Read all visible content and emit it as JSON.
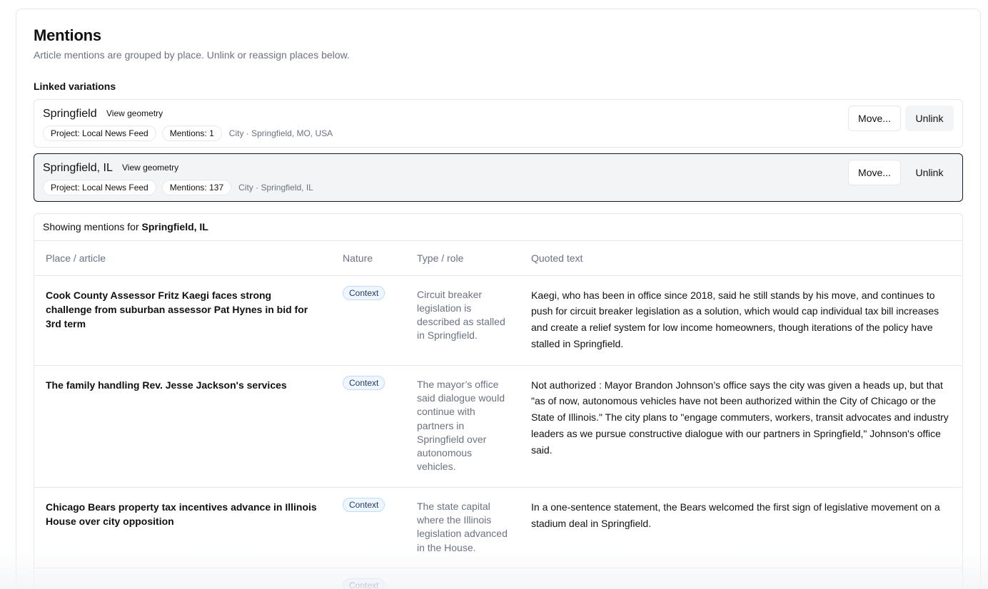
{
  "header": {
    "title": "Mentions",
    "subtitle": "Article mentions are grouped by place. Unlink or reassign places below."
  },
  "linked": {
    "label": "Linked variations",
    "items": [
      {
        "name": "Springfield",
        "view_geometry": "View geometry",
        "project": "Project: Local News Feed",
        "mentions": "Mentions: 1",
        "meta": "City · Springfield, MO, USA",
        "move_label": "Move...",
        "unlink_label": "Unlink",
        "selected": false
      },
      {
        "name": "Springfield, IL",
        "view_geometry": "View geometry",
        "project": "Project: Local News Feed",
        "mentions": "Mentions: 137",
        "meta": "City · Springfield, IL",
        "move_label": "Move...",
        "unlink_label": "Unlink",
        "selected": true
      }
    ]
  },
  "mentions": {
    "showing_prefix": "Showing mentions for",
    "showing_place": "Springfield, IL",
    "columns": [
      "Place / article",
      "Nature",
      "Type / role",
      "Quoted text"
    ],
    "rows": [
      {
        "article": "Cook County Assessor Fritz Kaegi faces strong challenge from suburban assessor Pat Hynes in bid for 3rd term",
        "nature": "Context",
        "role": "Circuit breaker legislation is described as stalled in Springfield.",
        "quote": "Kaegi, who has been in office since 2018, said he still stands by his move, and continues to push for circuit breaker legislation as a solution, which would cap individual tax bill increases and create a relief system for low income homeowners, though iterations of the policy have stalled in Springfield."
      },
      {
        "article": "The family handling Rev. Jesse Jackson's services",
        "nature": "Context",
        "role": "The mayor’s office said dialogue would continue with partners in Springfield over autonomous vehicles.",
        "quote": "Not authorized : Mayor Brandon Johnson’s office says the city was given a heads up, but that \"as of now, autonomous vehicles have not been authorized within the City of Chicago or the State of Illinois.\" The city plans to \"engage commuters, workers, transit advocates and industry leaders as we pursue constructive dialogue with our partners in Springfield,\" Johnson's office said."
      },
      {
        "article": "Chicago Bears property tax incentives advance in Illinois House over city opposition",
        "nature": "Context",
        "role": "The state capital where the Illinois legislation advanced in the House.",
        "quote": "In a one-sentence statement, the Bears welcomed the first sign of legislative movement on a stadium deal in Springfield."
      },
      {
        "article": "",
        "nature": "Context",
        "role": "",
        "quote": ""
      }
    ]
  }
}
